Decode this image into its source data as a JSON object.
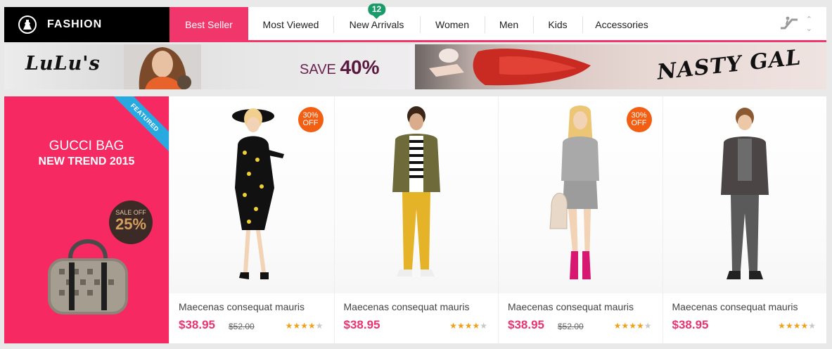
{
  "nav": {
    "brand": "FASHION",
    "brand_icon": "dress-icon",
    "tabs": [
      {
        "label": "Best Seller",
        "active": true
      },
      {
        "label": "Most Viewed"
      },
      {
        "label": "New Arrivals",
        "badge": "12"
      },
      {
        "label": "Women"
      },
      {
        "label": "Men"
      },
      {
        "label": "Kids"
      },
      {
        "label": "Accessories"
      }
    ],
    "tools": {
      "escalator_icon": "escalator-icon",
      "up_icon": "chevron-up-icon",
      "down_icon": "chevron-down-icon"
    }
  },
  "banners": {
    "left": {
      "logo": "LuLu's",
      "save_prefix": "SAVE",
      "save_value": "40%"
    },
    "right": {
      "logo": "NASTY GAL"
    }
  },
  "featured": {
    "ribbon": "FEATURED",
    "title": "GUCCI BAG",
    "subtitle": "NEW TREND 2015",
    "sale_label": "SALE OFF",
    "sale_value": "25%"
  },
  "products": [
    {
      "name": "Maecenas consequat mauris",
      "price": "$38.95",
      "old_price": "$52.00",
      "discount_top": "30%",
      "discount_bottom": "OFF",
      "rating": 4,
      "max_rating": 5
    },
    {
      "name": "Maecenas consequat mauris",
      "price": "$38.95",
      "old_price": "",
      "discount_top": "",
      "discount_bottom": "",
      "rating": 4,
      "max_rating": 5
    },
    {
      "name": "Maecenas consequat mauris",
      "price": "$38.95",
      "old_price": "$52.00",
      "discount_top": "30%",
      "discount_bottom": "OFF",
      "rating": 4,
      "max_rating": 5
    },
    {
      "name": "Maecenas consequat mauris",
      "price": "$38.95",
      "old_price": "",
      "discount_top": "",
      "discount_bottom": "",
      "rating": 4,
      "max_rating": 5
    }
  ],
  "colors": {
    "accent": "#f0366a",
    "featured_bg": "#f72962",
    "badge": "#1a9b6a",
    "discount": "#f25f12",
    "price": "#e83570",
    "star": "#f0a11c"
  }
}
